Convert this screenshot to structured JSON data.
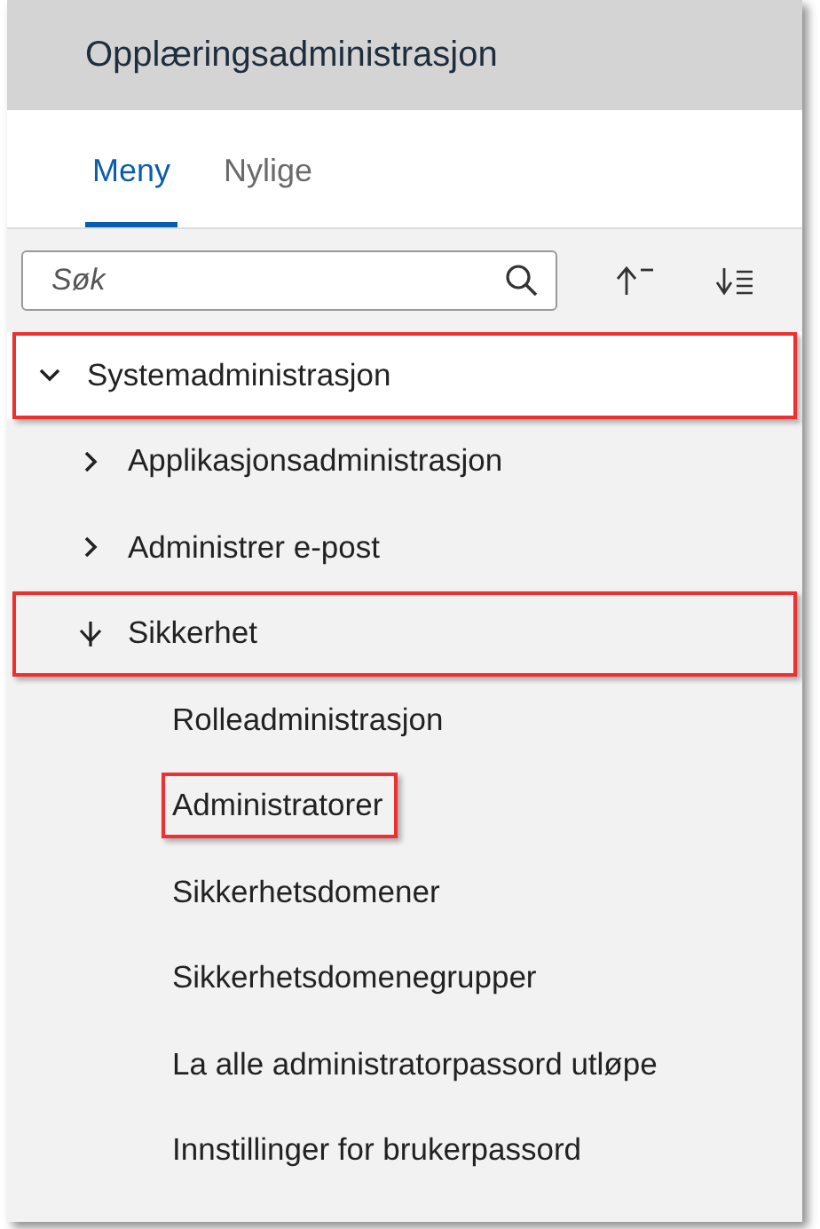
{
  "header": {
    "title": "Opplæringsadministrasjon"
  },
  "tabs": [
    {
      "label": "Meny",
      "selected": true
    },
    {
      "label": "Nylige",
      "selected": false
    }
  ],
  "search": {
    "placeholder": "Søk"
  },
  "tree": [
    {
      "label": "Systemadministrasjon",
      "expanded": true,
      "selected": true,
      "highlighted": true,
      "children": [
        {
          "label": "Applikasjonsadministrasjon",
          "expanded": false,
          "selected": false,
          "highlighted": false
        },
        {
          "label": "Administrer e-post",
          "expanded": false,
          "selected": false,
          "highlighted": false
        },
        {
          "label": "Sikkerhet",
          "expanded": true,
          "selected": false,
          "highlighted": true,
          "children": [
            {
              "label": "Rolleadministrasjon",
              "selected": false,
              "highlighted": false
            },
            {
              "label": "Administratorer",
              "selected": false,
              "highlighted": true
            },
            {
              "label": "Sikkerhetsdomener",
              "selected": false,
              "highlighted": false
            },
            {
              "label": "Sikkerhetsdomenegrupper",
              "selected": false,
              "highlighted": false
            },
            {
              "label": "La alle administratorpassord utløpe",
              "selected": false,
              "highlighted": false
            },
            {
              "label": "Innstillinger for brukerpassord",
              "selected": false,
              "highlighted": false
            }
          ]
        }
      ]
    }
  ]
}
